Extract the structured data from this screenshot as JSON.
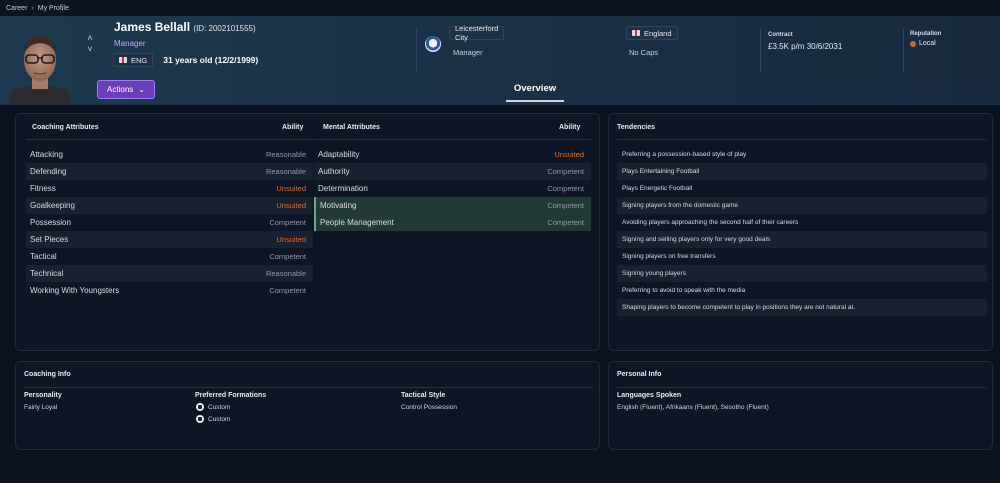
{
  "breadcrumb": {
    "root": "Career",
    "current": "My Profile"
  },
  "player": {
    "name": "James Bellall",
    "id_text": "(ID: 2002101555)",
    "role": "Manager",
    "nationality_code": "ENG",
    "age_text": "31 years old (12/2/1999)"
  },
  "actions": {
    "label": "Actions"
  },
  "club": {
    "name": "Leicesterford City",
    "role": "Manager"
  },
  "country": {
    "name": "England",
    "caps": "No Caps"
  },
  "contract": {
    "label": "Contract",
    "value": "£3.5K p/m 30/6/2031"
  },
  "reputation": {
    "label": "Reputation",
    "value": "Local"
  },
  "tabs": {
    "overview": "Overview"
  },
  "coaching_attributes": {
    "title": "Coaching Attributes",
    "ability_label": "Ability",
    "rows": [
      {
        "name": "Attacking",
        "value": "Reasonable"
      },
      {
        "name": "Defending",
        "value": "Reasonable"
      },
      {
        "name": "Fitness",
        "value": "Unsuited"
      },
      {
        "name": "Goalkeeping",
        "value": "Unsuited"
      },
      {
        "name": "Possession",
        "value": "Competent"
      },
      {
        "name": "Set Pieces",
        "value": "Unsuited"
      },
      {
        "name": "Tactical",
        "value": "Competent"
      },
      {
        "name": "Technical",
        "value": "Reasonable"
      },
      {
        "name": "Working With Youngsters",
        "value": "Competent"
      }
    ]
  },
  "mental_attributes": {
    "title": "Mental Attributes",
    "ability_label": "Ability",
    "rows": [
      {
        "name": "Adaptability",
        "value": "Unsuited"
      },
      {
        "name": "Authority",
        "value": "Competent"
      },
      {
        "name": "Determination",
        "value": "Competent"
      },
      {
        "name": "Motivating",
        "value": "Competent"
      },
      {
        "name": "People Management",
        "value": "Competent"
      }
    ]
  },
  "tendencies": {
    "title": "Tendencies",
    "items": [
      "Preferring a possession-based style of play",
      "Plays Entertaining Football",
      "Plays Energetic Football",
      "Signing players from the domestic game",
      "Avoiding players approaching the second half of their careers",
      "Signing and selling players only for very good deals",
      "Signing players on free transfers",
      "Signing young players",
      "Preferring to avoid to speak with the media",
      "Shaping players to become competent to play in positions they are not natural at."
    ]
  },
  "coaching_info": {
    "title": "Coaching Info",
    "personality_label": "Personality",
    "personality_value": "Fairly Loyal",
    "formations_label": "Preferred Formations",
    "formations": [
      "Custom",
      "Custom"
    ],
    "style_label": "Tactical Style",
    "style_value": "Control Possession"
  },
  "personal_info": {
    "title": "Personal Info",
    "languages_label": "Languages Spoken",
    "languages_value": "English (Fluent), Afrikaans (Fluent), Sesotho (Fluent)"
  },
  "colors": {
    "accent_purple": "#6a3fb8",
    "unsuited_orange": "#e2692a",
    "highlight_green": "#223a35"
  }
}
